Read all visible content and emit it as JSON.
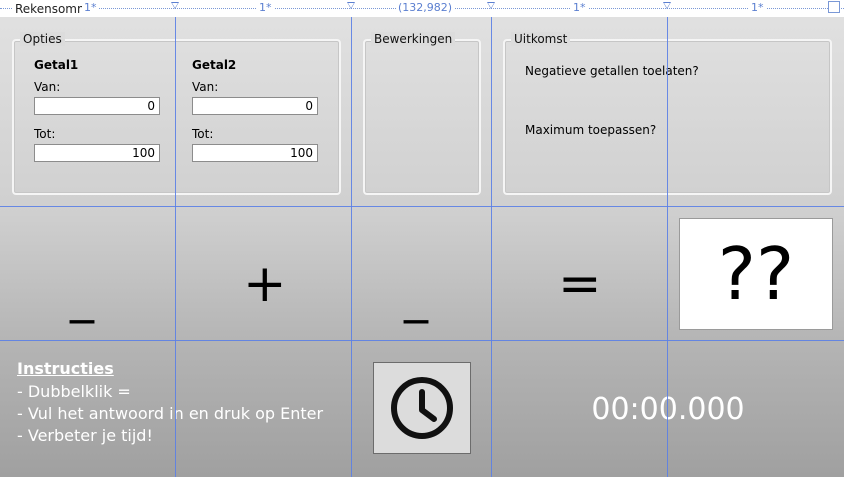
{
  "ruler": {
    "window_title": "Rekensomm",
    "col1_label": "1*",
    "col2_label": "1*",
    "col3_label": "(132,982)",
    "col4_label": "1*",
    "col5_label": "1*"
  },
  "opties": {
    "title": "Opties",
    "getal1": {
      "heading": "Getal1",
      "van_label": "Van:",
      "van_value": "0",
      "tot_label": "Tot:",
      "tot_value": "100"
    },
    "getal2": {
      "heading": "Getal2",
      "van_label": "Van:",
      "van_value": "0",
      "tot_label": "Tot:",
      "tot_value": "100"
    }
  },
  "bewerkingen": {
    "title": "Bewerkingen"
  },
  "uitkomst": {
    "title": "Uitkomst",
    "option_negative": "Negatieve getallen toelaten?",
    "option_maximum": "Maximum toepassen?"
  },
  "equation": {
    "operand1": "_",
    "operator": "+",
    "operand2": "_",
    "equals": "=",
    "answer": "??"
  },
  "instructions": {
    "title": "Instructies",
    "lines": [
      "- Dubbelklik =",
      "- Vul het antwoord in en druk op Enter",
      "- Verbeter je tijd!"
    ]
  },
  "timer": {
    "value": "00:00.000",
    "button_icon": "clock-icon"
  }
}
